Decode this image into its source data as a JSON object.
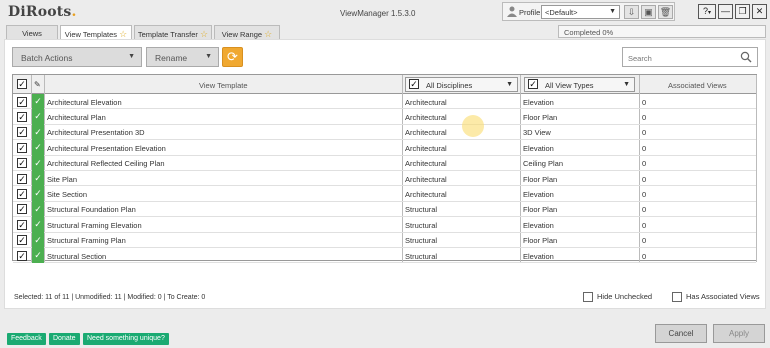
{
  "app": {
    "logo_main": "DiRoots",
    "logo_dot": ".",
    "title": "ViewManager 1.5.3.0"
  },
  "profile": {
    "label": "Profile",
    "value": "<Default>"
  },
  "window": {
    "help": "?",
    "minimize": "—",
    "restore": "❐",
    "close": "✕"
  },
  "progress": {
    "text": "Completed 0%",
    "percent": 0
  },
  "tabs": [
    {
      "label": "Views"
    },
    {
      "label": "View Templates"
    },
    {
      "label": "Template Transfer"
    },
    {
      "label": "View Range"
    }
  ],
  "toolbar": {
    "batch_actions": "Batch Actions",
    "rename": "Rename",
    "search_placeholder": "Search"
  },
  "grid": {
    "headers": {
      "view_template": "View Template",
      "disciplines": "All Disciplines",
      "view_types": "All View Types",
      "associated": "Associated Views"
    },
    "rows": [
      {
        "name": "Architectural Elevation",
        "discipline": "Architectural",
        "type": "Elevation",
        "count": "0"
      },
      {
        "name": "Architectural Plan",
        "discipline": "Architectural",
        "type": "Floor Plan",
        "count": "0"
      },
      {
        "name": "Architectural Presentation 3D",
        "discipline": "Architectural",
        "type": "3D View",
        "count": "0"
      },
      {
        "name": "Architectural Presentation Elevation",
        "discipline": "Architectural",
        "type": "Elevation",
        "count": "0"
      },
      {
        "name": "Architectural Reflected Ceiling Plan",
        "discipline": "Architectural",
        "type": "Ceiling Plan",
        "count": "0"
      },
      {
        "name": "Site Plan",
        "discipline": "Architectural",
        "type": "Floor Plan",
        "count": "0"
      },
      {
        "name": "Site Section",
        "discipline": "Architectural",
        "type": "Elevation",
        "count": "0"
      },
      {
        "name": "Structural Foundation Plan",
        "discipline": "Structural",
        "type": "Floor Plan",
        "count": "0"
      },
      {
        "name": "Structural Framing Elevation",
        "discipline": "Structural",
        "type": "Elevation",
        "count": "0"
      },
      {
        "name": "Structural Framing Plan",
        "discipline": "Structural",
        "type": "Floor Plan",
        "count": "0"
      },
      {
        "name": "Structural Section",
        "discipline": "Structural",
        "type": "Elevation",
        "count": "0"
      }
    ]
  },
  "status": {
    "text": "Selected: 11 of 11 | Unmodified: 11 | Modified: 0 | To Create: 0"
  },
  "options": {
    "hide_unchecked": "Hide Unchecked",
    "has_associated": "Has Associated Views"
  },
  "footer": {
    "feedback": "Feedback",
    "donate": "Donate",
    "need": "Need something unique?",
    "cancel": "Cancel",
    "apply": "Apply"
  },
  "colors": {
    "accent_green": "#4caf50",
    "footer_green": "#1aaa72",
    "refresh_orange": "#f0a830"
  }
}
